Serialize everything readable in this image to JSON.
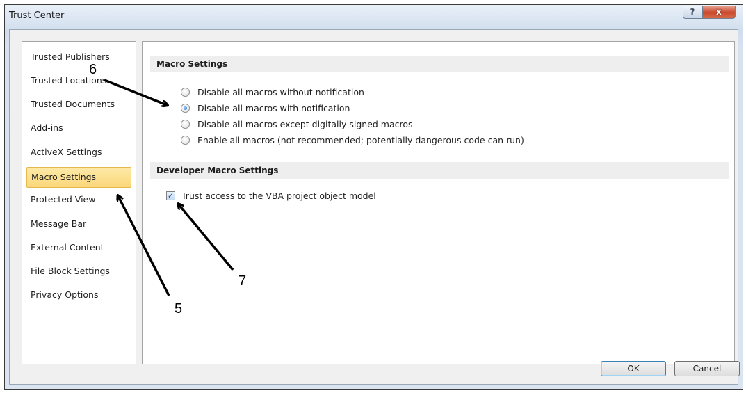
{
  "window": {
    "title": "Trust Center",
    "help_label": "?",
    "close_label": "x"
  },
  "sidebar": {
    "items": [
      {
        "label": "Trusted Publishers"
      },
      {
        "label": "Trusted Locations"
      },
      {
        "label": "Trusted Documents"
      },
      {
        "label": "Add-ins"
      },
      {
        "label": "ActiveX Settings"
      },
      {
        "label": "Macro Settings",
        "selected": true
      },
      {
        "label": "Protected View"
      },
      {
        "label": "Message Bar"
      },
      {
        "label": "External Content"
      },
      {
        "label": "File Block Settings"
      },
      {
        "label": "Privacy Options"
      }
    ]
  },
  "macro_settings": {
    "header": "Macro Settings",
    "options": [
      {
        "label": "Disable all macros without notification",
        "checked": false
      },
      {
        "label": "Disable all macros with notification",
        "checked": true
      },
      {
        "label": "Disable all macros except digitally signed macros",
        "checked": false
      },
      {
        "label": "Enable all macros (not recommended; potentially dangerous code can run)",
        "checked": false
      }
    ]
  },
  "developer_settings": {
    "header": "Developer Macro Settings",
    "vba_label": "Trust access to the VBA project object model",
    "vba_checked": true,
    "check_glyph": "✓"
  },
  "buttons": {
    "ok": "OK",
    "cancel": "Cancel"
  },
  "annotations": {
    "five": "5",
    "six": "6",
    "seven": "7"
  },
  "colors": {
    "selected_item_bg": "#fbd77a",
    "close_button": "#c9492c",
    "section_header_bg": "#eeeeee"
  }
}
